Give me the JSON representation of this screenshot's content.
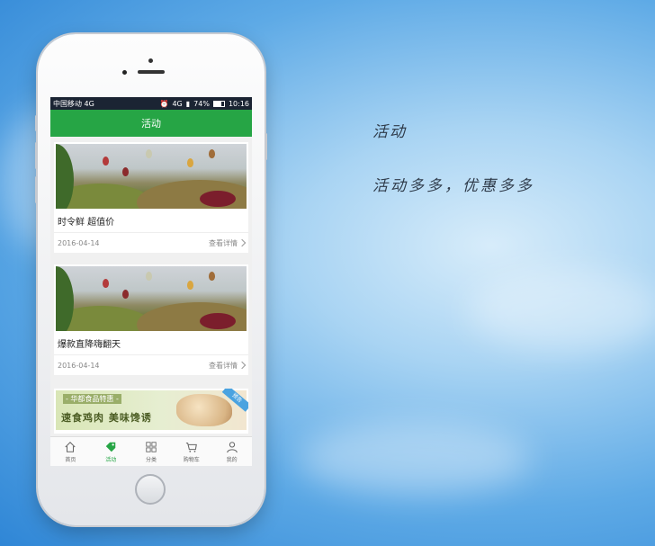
{
  "promo": {
    "title": "活动",
    "subtitle": "活动多多，优惠多多"
  },
  "statusbar": {
    "carrier": "中国移动 4G",
    "network": "4G",
    "battery": "74%",
    "time": "10:16"
  },
  "app": {
    "title": "活动"
  },
  "activities": [
    {
      "title": "时令鲜 超值价",
      "date": "2016-04-14",
      "detail_label": "查看详情"
    },
    {
      "title": "爆款直降嗨翻天",
      "date": "2016-04-14",
      "detail_label": "查看详情"
    }
  ],
  "promo_banner": {
    "top_text": "- 华都食品特惠 -",
    "main_text": "速食鸡肉 美味馋诱",
    "corner_tag": "预告"
  },
  "tabs": [
    {
      "label": "首页",
      "icon": "home-icon",
      "active": false
    },
    {
      "label": "活动",
      "icon": "tag-icon",
      "active": true
    },
    {
      "label": "分类",
      "icon": "grid-icon",
      "active": false
    },
    {
      "label": "购物车",
      "icon": "cart-icon",
      "active": false
    },
    {
      "label": "我的",
      "icon": "user-icon",
      "active": false
    }
  ],
  "colors": {
    "accent": "#26a545",
    "statusbar": "#1b2433"
  }
}
